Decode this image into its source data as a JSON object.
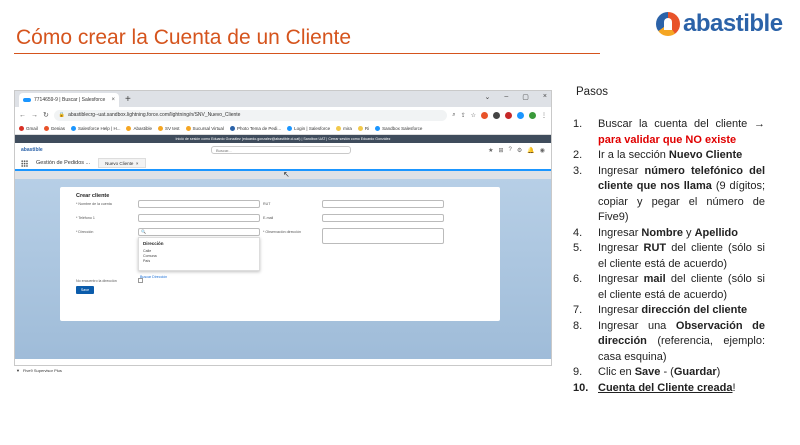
{
  "slide": {
    "title": "Cómo crear la Cuenta de un Cliente",
    "logo_text": "abastible",
    "steps_title": "Pasos",
    "colors": {
      "title": "#d5541d",
      "highlight": "#e00000",
      "brand_blue": "#2b62a8"
    }
  },
  "browser": {
    "tab_title": "7714659-9 | Buscar | Salesforce",
    "tab_close": "×",
    "new_tab": "+",
    "window_controls": [
      "⌄",
      "–",
      "▢",
      "×"
    ],
    "url": "abastiblecrg--uat.sandbox.lightning.force.com/lightning/n/SNV_Nuevo_Cliente",
    "bookmarks": [
      "Gmail",
      "Genias",
      "Salesforce Help | H...",
      "Abastible",
      "SV test",
      "Sucursal Virtual",
      "Photo Tema de Pedi...",
      "Login | Salesforce",
      "mira",
      "Ri",
      "Sandbox Salesforce"
    ],
    "banner": "Inició de sesión como Eduardo González (eduardo.gonzalez@abastible.cl.uat) | Sandbox UAT | Cerrar sesión como Eduardo González",
    "app_logo": "abastible",
    "search_placeholder": "Buscar...",
    "app_name": "Gestión de Pedidos ...",
    "active_tab": "Nuevo Cliente",
    "form": {
      "title": "Crear cliente",
      "account_name_label": "* Nombre de la cuenta",
      "rut_label": "RUT",
      "phone_label": "* Teléfono 1",
      "email_label": "E-mail",
      "address_label": "* Dirección",
      "address_search_placeholder": "🔍",
      "address_note_label": "* Observación dirección",
      "dropdown_title": "Dirección",
      "dropdown_items": [
        "Calle",
        "Comuna",
        "País"
      ],
      "search_address_link": "Buscar Dirección",
      "not_found_label": "No encuentro la dirección",
      "save_button": "Save"
    },
    "utility_bar": "Five9 Supervisor Plus"
  },
  "steps": [
    {
      "num": "1.",
      "parts": [
        {
          "t": "Buscar la cuenta del cliente "
        },
        {
          "t": "→ ",
          "s": "b"
        },
        {
          "t": "para validar que NO existe",
          "s": "red"
        }
      ]
    },
    {
      "num": "2.",
      "parts": [
        {
          "t": "Ir a la sección "
        },
        {
          "t": "Nuevo Cliente",
          "s": "b"
        }
      ]
    },
    {
      "num": "3.",
      "parts": [
        {
          "t": "Ingresar "
        },
        {
          "t": "número telefónico del cliente que nos llama",
          "s": "b"
        },
        {
          "t": " (9 dígitos; copiar y pegar el número de Five9)"
        }
      ]
    },
    {
      "num": "4.",
      "parts": [
        {
          "t": "Ingresar "
        },
        {
          "t": "Nombre",
          "s": "b"
        },
        {
          "t": " y "
        },
        {
          "t": "Apellido",
          "s": "b"
        }
      ]
    },
    {
      "num": "5.",
      "parts": [
        {
          "t": "Ingresar "
        },
        {
          "t": "RUT",
          "s": "b"
        },
        {
          "t": " del cliente (sólo si el cliente está de acuerdo)"
        }
      ]
    },
    {
      "num": "6.",
      "parts": [
        {
          "t": "Ingresar "
        },
        {
          "t": "mail",
          "s": "b"
        },
        {
          "t": " del cliente (sólo si el cliente está de acuerdo)"
        }
      ]
    },
    {
      "num": "7.",
      "parts": [
        {
          "t": "Ingresar "
        },
        {
          "t": "dirección del cliente",
          "s": "b"
        }
      ]
    },
    {
      "num": "8.",
      "parts": [
        {
          "t": "Ingresar una "
        },
        {
          "t": "Observación de dirección",
          "s": "b"
        },
        {
          "t": " (referencia, ejemplo: casa esquina)"
        }
      ]
    },
    {
      "num": "9.",
      "parts": [
        {
          "t": "Clic en "
        },
        {
          "t": "Save",
          "s": "b"
        },
        {
          "t": " - ("
        },
        {
          "t": "Guardar",
          "s": "b"
        },
        {
          "t": ")"
        }
      ]
    },
    {
      "num": "10.",
      "numBold": true,
      "parts": [
        {
          "t": "Cuenta del Cliente creada",
          "s": "u"
        },
        {
          "t": "!"
        }
      ]
    }
  ]
}
